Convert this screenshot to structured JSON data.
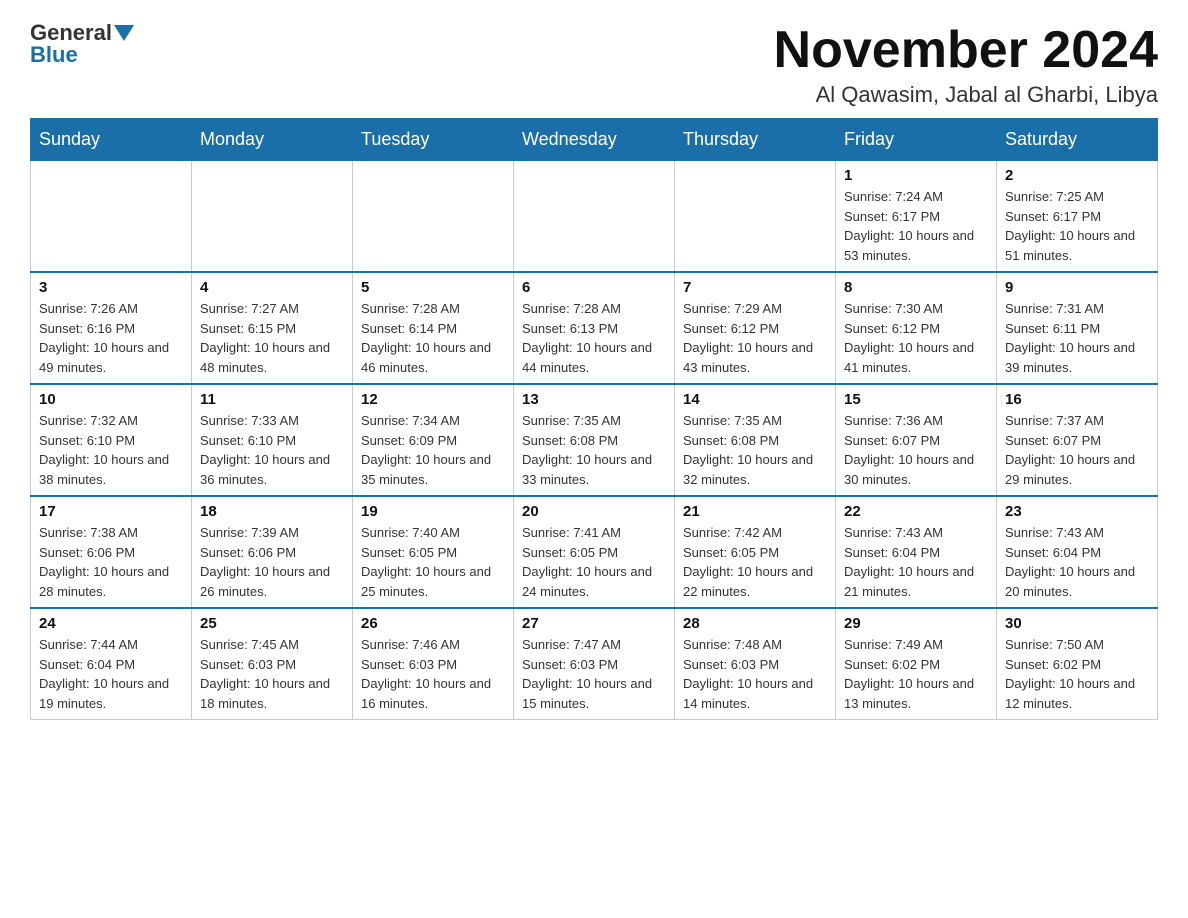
{
  "header": {
    "logo_general": "General",
    "logo_blue": "Blue",
    "month_title": "November 2024",
    "location": "Al Qawasim, Jabal al Gharbi, Libya"
  },
  "weekdays": [
    "Sunday",
    "Monday",
    "Tuesday",
    "Wednesday",
    "Thursday",
    "Friday",
    "Saturday"
  ],
  "weeks": [
    [
      {
        "day": "",
        "info": ""
      },
      {
        "day": "",
        "info": ""
      },
      {
        "day": "",
        "info": ""
      },
      {
        "day": "",
        "info": ""
      },
      {
        "day": "",
        "info": ""
      },
      {
        "day": "1",
        "info": "Sunrise: 7:24 AM\nSunset: 6:17 PM\nDaylight: 10 hours and 53 minutes."
      },
      {
        "day": "2",
        "info": "Sunrise: 7:25 AM\nSunset: 6:17 PM\nDaylight: 10 hours and 51 minutes."
      }
    ],
    [
      {
        "day": "3",
        "info": "Sunrise: 7:26 AM\nSunset: 6:16 PM\nDaylight: 10 hours and 49 minutes."
      },
      {
        "day": "4",
        "info": "Sunrise: 7:27 AM\nSunset: 6:15 PM\nDaylight: 10 hours and 48 minutes."
      },
      {
        "day": "5",
        "info": "Sunrise: 7:28 AM\nSunset: 6:14 PM\nDaylight: 10 hours and 46 minutes."
      },
      {
        "day": "6",
        "info": "Sunrise: 7:28 AM\nSunset: 6:13 PM\nDaylight: 10 hours and 44 minutes."
      },
      {
        "day": "7",
        "info": "Sunrise: 7:29 AM\nSunset: 6:12 PM\nDaylight: 10 hours and 43 minutes."
      },
      {
        "day": "8",
        "info": "Sunrise: 7:30 AM\nSunset: 6:12 PM\nDaylight: 10 hours and 41 minutes."
      },
      {
        "day": "9",
        "info": "Sunrise: 7:31 AM\nSunset: 6:11 PM\nDaylight: 10 hours and 39 minutes."
      }
    ],
    [
      {
        "day": "10",
        "info": "Sunrise: 7:32 AM\nSunset: 6:10 PM\nDaylight: 10 hours and 38 minutes."
      },
      {
        "day": "11",
        "info": "Sunrise: 7:33 AM\nSunset: 6:10 PM\nDaylight: 10 hours and 36 minutes."
      },
      {
        "day": "12",
        "info": "Sunrise: 7:34 AM\nSunset: 6:09 PM\nDaylight: 10 hours and 35 minutes."
      },
      {
        "day": "13",
        "info": "Sunrise: 7:35 AM\nSunset: 6:08 PM\nDaylight: 10 hours and 33 minutes."
      },
      {
        "day": "14",
        "info": "Sunrise: 7:35 AM\nSunset: 6:08 PM\nDaylight: 10 hours and 32 minutes."
      },
      {
        "day": "15",
        "info": "Sunrise: 7:36 AM\nSunset: 6:07 PM\nDaylight: 10 hours and 30 minutes."
      },
      {
        "day": "16",
        "info": "Sunrise: 7:37 AM\nSunset: 6:07 PM\nDaylight: 10 hours and 29 minutes."
      }
    ],
    [
      {
        "day": "17",
        "info": "Sunrise: 7:38 AM\nSunset: 6:06 PM\nDaylight: 10 hours and 28 minutes."
      },
      {
        "day": "18",
        "info": "Sunrise: 7:39 AM\nSunset: 6:06 PM\nDaylight: 10 hours and 26 minutes."
      },
      {
        "day": "19",
        "info": "Sunrise: 7:40 AM\nSunset: 6:05 PM\nDaylight: 10 hours and 25 minutes."
      },
      {
        "day": "20",
        "info": "Sunrise: 7:41 AM\nSunset: 6:05 PM\nDaylight: 10 hours and 24 minutes."
      },
      {
        "day": "21",
        "info": "Sunrise: 7:42 AM\nSunset: 6:05 PM\nDaylight: 10 hours and 22 minutes."
      },
      {
        "day": "22",
        "info": "Sunrise: 7:43 AM\nSunset: 6:04 PM\nDaylight: 10 hours and 21 minutes."
      },
      {
        "day": "23",
        "info": "Sunrise: 7:43 AM\nSunset: 6:04 PM\nDaylight: 10 hours and 20 minutes."
      }
    ],
    [
      {
        "day": "24",
        "info": "Sunrise: 7:44 AM\nSunset: 6:04 PM\nDaylight: 10 hours and 19 minutes."
      },
      {
        "day": "25",
        "info": "Sunrise: 7:45 AM\nSunset: 6:03 PM\nDaylight: 10 hours and 18 minutes."
      },
      {
        "day": "26",
        "info": "Sunrise: 7:46 AM\nSunset: 6:03 PM\nDaylight: 10 hours and 16 minutes."
      },
      {
        "day": "27",
        "info": "Sunrise: 7:47 AM\nSunset: 6:03 PM\nDaylight: 10 hours and 15 minutes."
      },
      {
        "day": "28",
        "info": "Sunrise: 7:48 AM\nSunset: 6:03 PM\nDaylight: 10 hours and 14 minutes."
      },
      {
        "day": "29",
        "info": "Sunrise: 7:49 AM\nSunset: 6:02 PM\nDaylight: 10 hours and 13 minutes."
      },
      {
        "day": "30",
        "info": "Sunrise: 7:50 AM\nSunset: 6:02 PM\nDaylight: 10 hours and 12 minutes."
      }
    ]
  ]
}
